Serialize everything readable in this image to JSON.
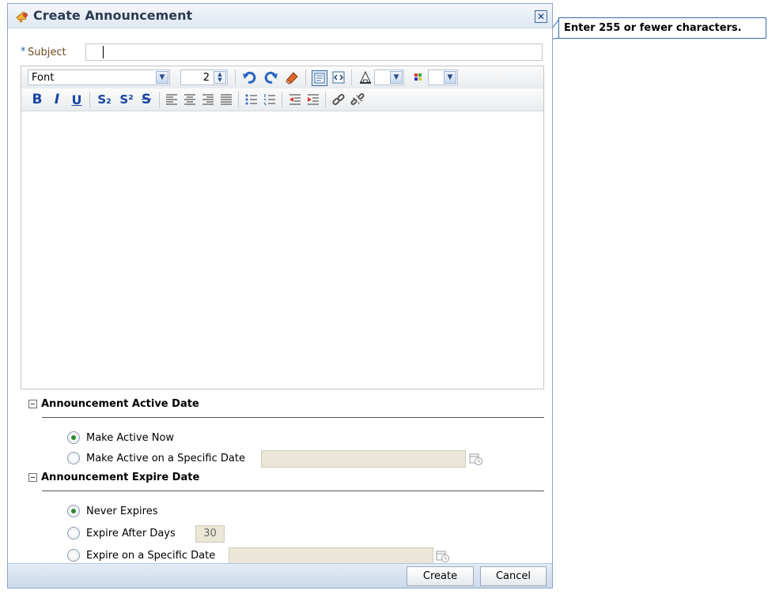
{
  "dialog": {
    "title": "Create Announcement",
    "title_icon": "announcement-icon",
    "close_icon": "close-icon",
    "close_glyph": "✕"
  },
  "subject": {
    "required_marker": "*",
    "label": "Subject",
    "value": ""
  },
  "tooltip": {
    "text": "Enter 255 or fewer characters."
  },
  "editor": {
    "font_label": "Font",
    "font_size": "2",
    "toolbar1_icons": [
      "undo-icon",
      "redo-icon",
      "clear-formatting-icon",
      "rich-text-mode-icon",
      "source-code-mode-icon",
      "font-color-icon",
      "background-color-icon"
    ],
    "toolbar2_icons": [
      "bold-icon",
      "italic-icon",
      "underline-icon",
      "subscript-icon",
      "superscript-icon",
      "strikethrough-icon",
      "align-left-icon",
      "align-center-icon",
      "align-right-icon",
      "justify-icon",
      "bulleted-list-icon",
      "numbered-list-icon",
      "outdent-icon",
      "indent-icon",
      "insert-link-icon",
      "remove-link-icon"
    ],
    "bold_glyph": "B",
    "italic_glyph": "I",
    "underline_glyph": "U",
    "subscript_glyph": "S₂",
    "superscript_glyph": "S²",
    "strike_glyph": "S",
    "body_text": ""
  },
  "active_section": {
    "title": "Announcement Active Date",
    "options": [
      {
        "label": "Make Active Now",
        "checked": true
      },
      {
        "label": "Make Active on a Specific Date",
        "checked": false
      }
    ],
    "date_value": ""
  },
  "expire_section": {
    "title": "Announcement Expire Date",
    "options": [
      {
        "label": "Never Expires",
        "checked": true
      },
      {
        "label": "Expire After Days",
        "checked": false
      },
      {
        "label": "Expire on a Specific Date",
        "checked": false
      }
    ],
    "days_value": "30",
    "date_value": ""
  },
  "footer": {
    "create_label": "Create",
    "cancel_label": "Cancel"
  },
  "colors": {
    "accent": "#2d67b2",
    "titlebar": "#dfe7f2",
    "disabled_input": "#eae6d8",
    "radio_checked": "#2e8b2e"
  }
}
